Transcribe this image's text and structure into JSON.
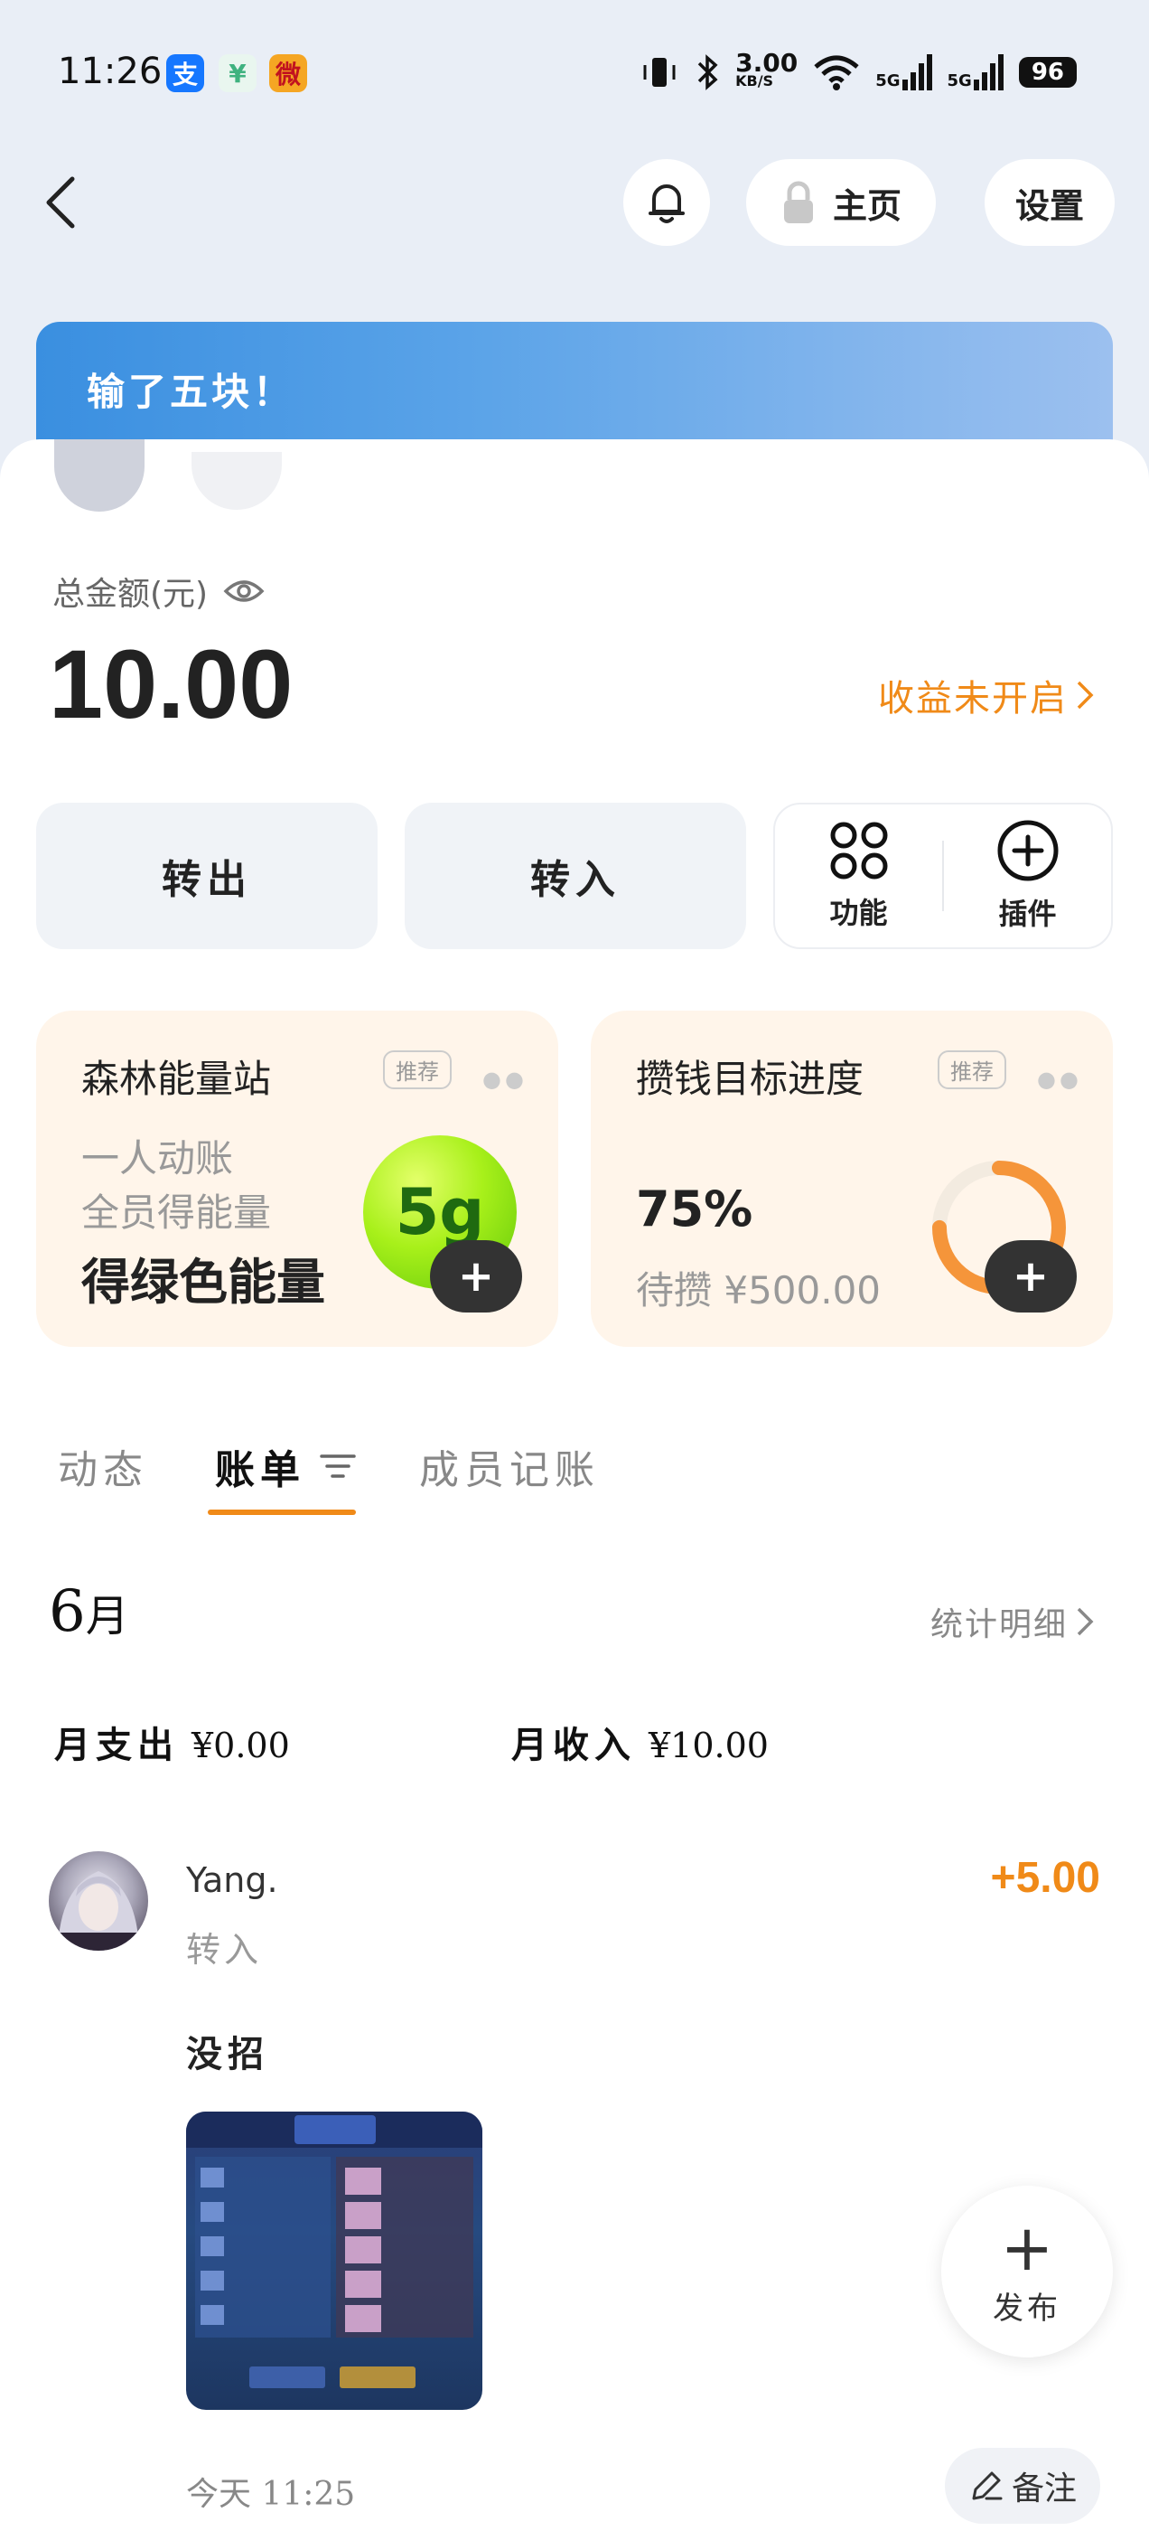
{
  "status_bar": {
    "time": "11:26",
    "app_icons": [
      {
        "name": "alipay-icon",
        "glyph": "支",
        "color": "#1677ff"
      },
      {
        "name": "fund-icon",
        "glyph": "¥",
        "color": "#3fb27f"
      },
      {
        "name": "weibo-icon",
        "glyph": "微",
        "color": "#f5a623"
      }
    ],
    "net_speed": "3.00",
    "net_unit": "KB/S",
    "signal_1": "5G",
    "signal_2": "5G",
    "battery": "96"
  },
  "header": {
    "home_label": "主页",
    "settings_label": "设置"
  },
  "banner": {
    "text": "输了五块！"
  },
  "account": {
    "total_label": "总金额(元)",
    "amount": "10.00",
    "yield_link": "收益未开启"
  },
  "actions": {
    "transfer_out": "转出",
    "transfer_in": "转入",
    "functions": "功能",
    "plugins": "插件"
  },
  "cards": {
    "forest": {
      "title": "森林能量站",
      "tag": "推荐",
      "line1": "一人动账",
      "line2": "全员得能量",
      "big": "得绿色能量",
      "ball_text": "5g"
    },
    "goal": {
      "title": "攒钱目标进度",
      "tag": "推荐",
      "percent": "75%",
      "remaining": "待攒 ¥500.00",
      "progress": 0.75
    }
  },
  "tabs": [
    {
      "label": "动态",
      "active": false
    },
    {
      "label": "账单",
      "active": true
    },
    {
      "label": "成员记账",
      "active": false
    }
  ],
  "bill": {
    "month": "6",
    "month_unit": "月",
    "stats_link": "统计明细",
    "month_out_label": "月支出",
    "month_out_value": "¥0.00",
    "month_in_label": "月收入",
    "month_in_value": "¥10.00"
  },
  "entry": {
    "name": "Yang.",
    "type": "转入",
    "amount": "+5.00",
    "note": "没招",
    "time": "今天 11:25"
  },
  "fab": {
    "publish_label": "发布",
    "remark_label": "备注"
  },
  "colors": {
    "accent_orange": "#f08a18",
    "banner_blue": "#3a8fe0",
    "card_bg": "#fff5ea"
  }
}
